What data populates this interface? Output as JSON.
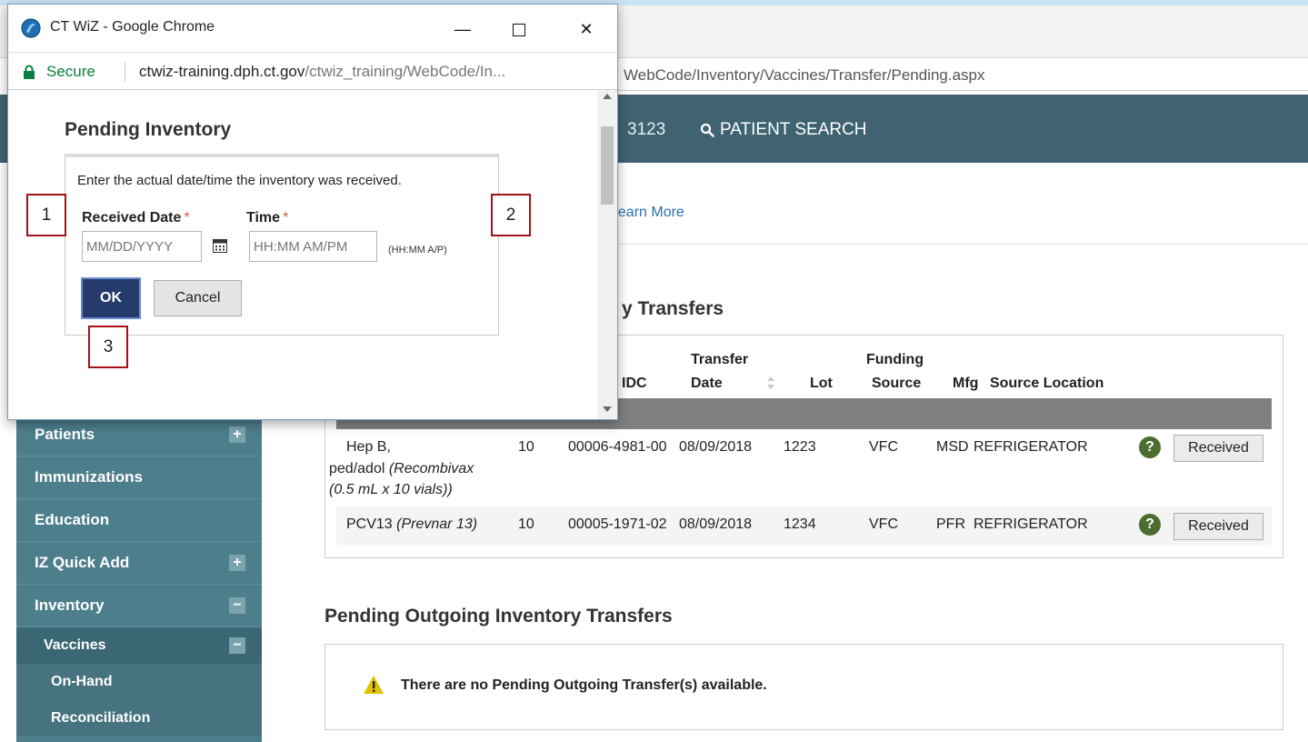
{
  "background_browser": {
    "address_url": "WebCode/Inventory/Vaccines/Transfer/Pending.aspx",
    "header_number": "3123",
    "patient_search_label": "PATIENT SEARCH",
    "learn_more_text": "Learn More"
  },
  "sidebar": {
    "items": [
      {
        "label": "Patients",
        "toggle": "+"
      },
      {
        "label": "Immunizations"
      },
      {
        "label": "Education"
      },
      {
        "label": "IZ Quick Add",
        "toggle": "+"
      },
      {
        "label": "Inventory",
        "toggle": "−"
      }
    ],
    "subitem": {
      "label": "Vaccines",
      "toggle": "−"
    },
    "subsubitems": [
      "On-Hand",
      "Reconciliation"
    ]
  },
  "incoming": {
    "title": "Pending Incoming Inventory Transfers",
    "title_visible_part": "y Transfers",
    "headers": {
      "ndc": "NDC",
      "ndc_visible": "IDC",
      "transfer_line1": "Transfer",
      "transfer_line2": "Date",
      "lot": "Lot",
      "funding_line1": "Funding",
      "funding_line2": "Source",
      "mfg": "Mfg",
      "source_location": "Source Location"
    },
    "rows": [
      {
        "vaccine_line1": "Hep B,",
        "vaccine_line2_plain": "ped/adol ",
        "vaccine_line2_italic": "(Recombivax",
        "vaccine_line3_italic": "(0.5 mL x 10 vials))",
        "qty": "10",
        "ndc": "00006-4981-00",
        "date": "08/09/2018",
        "lot": "1223",
        "funding": "VFC",
        "mfg": "MSD",
        "location": "REFRIGERATOR",
        "button": "Received"
      },
      {
        "vaccine_plain": "PCV13 ",
        "vaccine_italic": "(Prevnar 13)",
        "qty": "10",
        "ndc": "00005-1971-02",
        "date": "08/09/2018",
        "lot": "1234",
        "funding": "VFC",
        "mfg": "PFR",
        "location": "REFRIGERATOR",
        "button": "Received"
      }
    ]
  },
  "outgoing": {
    "title": "Pending Outgoing Inventory Transfers",
    "empty_message": "There are no Pending Outgoing Transfer(s) available."
  },
  "popup": {
    "window_title": "CT WiZ - Google Chrome",
    "secure_label": "Secure",
    "url_host": "ctwiz-training.dph.ct.gov",
    "url_path": "/ctwiz_training/WebCode/In...",
    "heading": "Pending Inventory",
    "instruction": "Enter the actual date/time the inventory was received.",
    "received_date_label": "Received Date",
    "time_label": "Time",
    "required_mark": "*",
    "date_placeholder": "MM/DD/YYYY",
    "time_placeholder": "HH:MM AM/PM",
    "time_hint": "(HH:MM A/P)",
    "ok_label": "OK",
    "cancel_label": "Cancel"
  },
  "callouts": [
    "1",
    "2",
    "3"
  ],
  "colors": {
    "header_bar": "#3f6371",
    "sidebar": "#4d7e8c",
    "ok_button": "#253b6b",
    "callout_border": "#a80f16",
    "help_icon": "#4b6e2f",
    "warning": "#e0c200",
    "secure_green": "#0b8043"
  },
  "icons": {
    "search": "search-icon",
    "calendar": "calendar-icon",
    "lock": "lock-icon",
    "help": "help-icon",
    "warning": "warning-icon",
    "logo": "ctwiz-logo-icon"
  }
}
